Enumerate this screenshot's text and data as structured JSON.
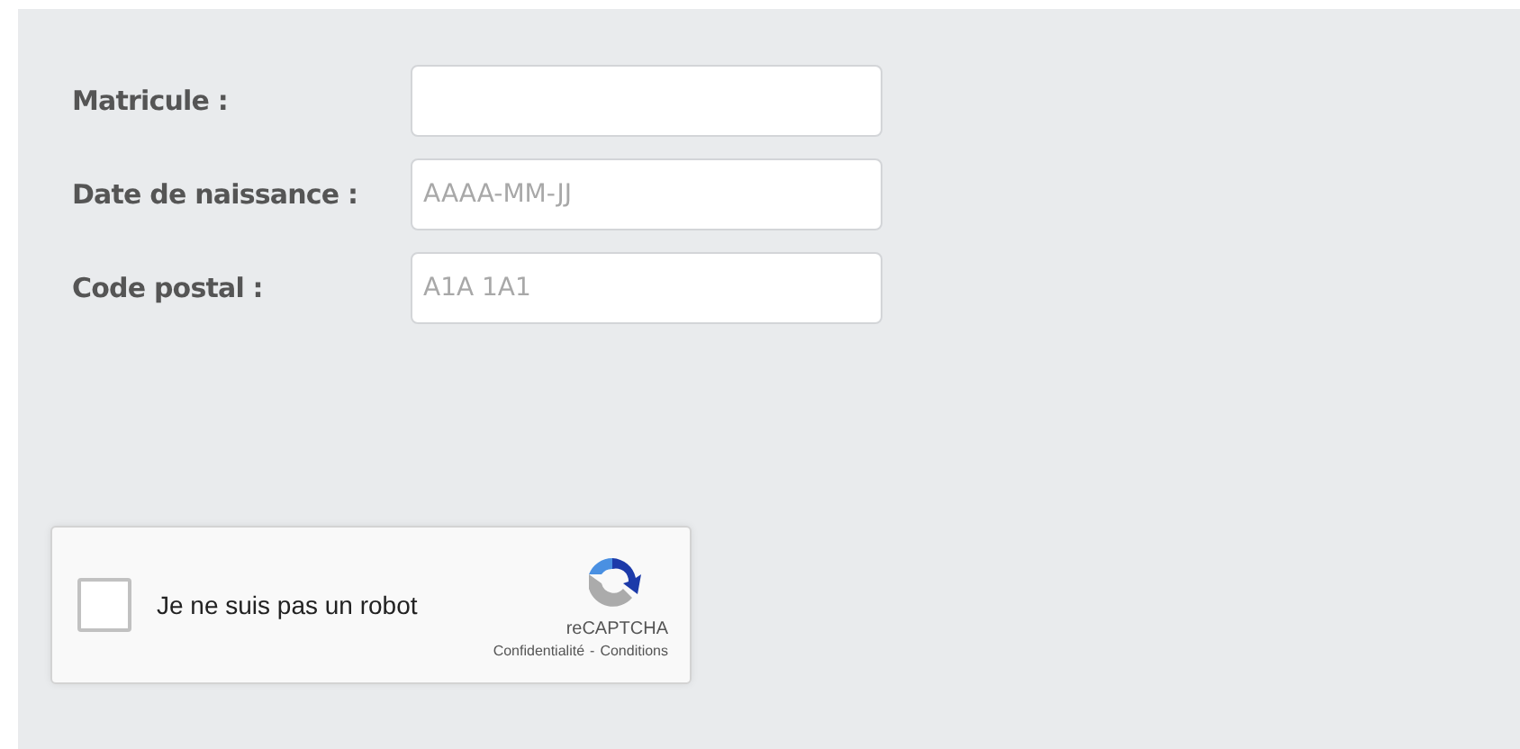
{
  "fields": [
    {
      "label": "Matricule :"
    },
    {
      "label": "Date de naissance :",
      "placeholder": "AAAA-MM-JJ"
    },
    {
      "label": "Code postal :",
      "placeholder": "A1A 1A1"
    }
  ],
  "captcha": {
    "label": "Je ne suis pas un robot",
    "checked": false,
    "brand": "reCAPTCHA",
    "privacy_link": "Confidentialité",
    "separator": "-",
    "terms_link": "Conditions"
  }
}
